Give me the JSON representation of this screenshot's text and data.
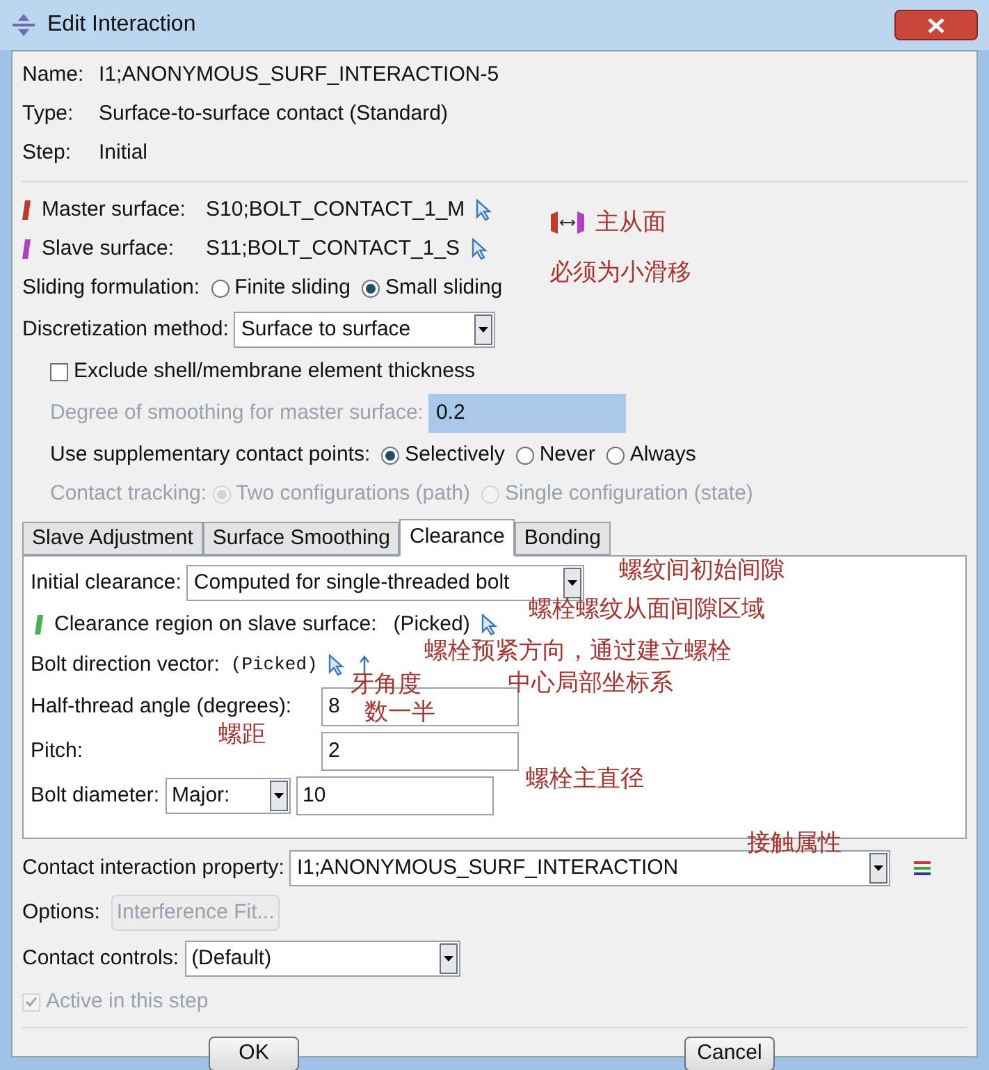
{
  "window": {
    "title": "Edit Interaction"
  },
  "info": [
    {
      "label": "Name:",
      "value": "I1;ANONYMOUS_SURF_INTERACTION-5"
    },
    {
      "label": "Type:",
      "value": "Surface-to-surface contact (Standard)"
    },
    {
      "label": "Step:",
      "value": "Initial"
    }
  ],
  "surfaces": [
    {
      "label": "Master surface:",
      "value": "S10;BOLT_CONTACT_1_M",
      "color": "#c0392b"
    },
    {
      "label": "Slave surface:",
      "value": "S11;BOLT_CONTACT_1_S",
      "color": "#b040c0"
    }
  ],
  "sliding": {
    "label": "Sliding formulation:",
    "options": [
      {
        "label": "Finite sliding",
        "selected": false
      },
      {
        "label": "Small sliding",
        "selected": true
      }
    ]
  },
  "discretization": {
    "label": "Discretization method:",
    "value": "Surface to surface"
  },
  "exclude": {
    "label": "Exclude shell/membrane element thickness",
    "checked": false
  },
  "smoothing": {
    "label": "Degree of smoothing for master surface:",
    "value": "0.2",
    "disabled": true
  },
  "supplementary": {
    "label": "Use supplementary contact points:",
    "options": [
      {
        "label": "Selectively",
        "selected": true
      },
      {
        "label": "Never",
        "selected": false
      },
      {
        "label": "Always",
        "selected": false
      }
    ]
  },
  "tracking": {
    "label": "Contact tracking:",
    "disabled": true,
    "options": [
      {
        "label": "Two configurations (path)",
        "selected": true
      },
      {
        "label": "Single configuration (state)",
        "selected": false
      }
    ]
  },
  "tabs": [
    {
      "label": "Slave Adjustment",
      "selected": false
    },
    {
      "label": "Surface Smoothing",
      "selected": false
    },
    {
      "label": "Clearance",
      "selected": true
    },
    {
      "label": "Bonding",
      "selected": false
    }
  ],
  "clearance": {
    "initial": {
      "label": "Initial clearance:",
      "value": "Computed for single-threaded bolt"
    },
    "region": {
      "label": "Clearance region on slave surface:",
      "value": "(Picked)"
    },
    "bolt_direction": {
      "label": "Bolt direction vector:",
      "value": "(Picked)"
    },
    "half_thread": {
      "label": "Half-thread angle (degrees):",
      "value": "8"
    },
    "pitch": {
      "label": "Pitch:",
      "value": "2"
    },
    "diameter": {
      "label": "Bolt diameter:",
      "type": "Major:",
      "value": "10"
    }
  },
  "property": {
    "label": "Contact interaction property:",
    "value": "I1;ANONYMOUS_SURF_INTERACTION"
  },
  "options": {
    "label": "Options:",
    "button": "Interference Fit...",
    "disabled": true
  },
  "controls": {
    "label": "Contact controls:",
    "value": "(Default)"
  },
  "active": {
    "label": "Active in this step",
    "checked": true,
    "disabled": true
  },
  "buttons": [
    "OK",
    "Cancel"
  ],
  "annotations": [
    {
      "text": "主从面",
      "kind": "icon-note"
    },
    {
      "text": "必须为小滑移"
    },
    {
      "text": "螺纹间初始间隙"
    },
    {
      "text": "螺栓螺纹从面间隙区域"
    },
    {
      "text": "螺栓预紧方向，通过建立螺栓"
    },
    {
      "text": "牙角度"
    },
    {
      "text": "中心局部坐标系"
    },
    {
      "text": "数一半"
    },
    {
      "text": "螺距"
    },
    {
      "text": "螺栓主直径"
    },
    {
      "text": "接触属性"
    }
  ]
}
